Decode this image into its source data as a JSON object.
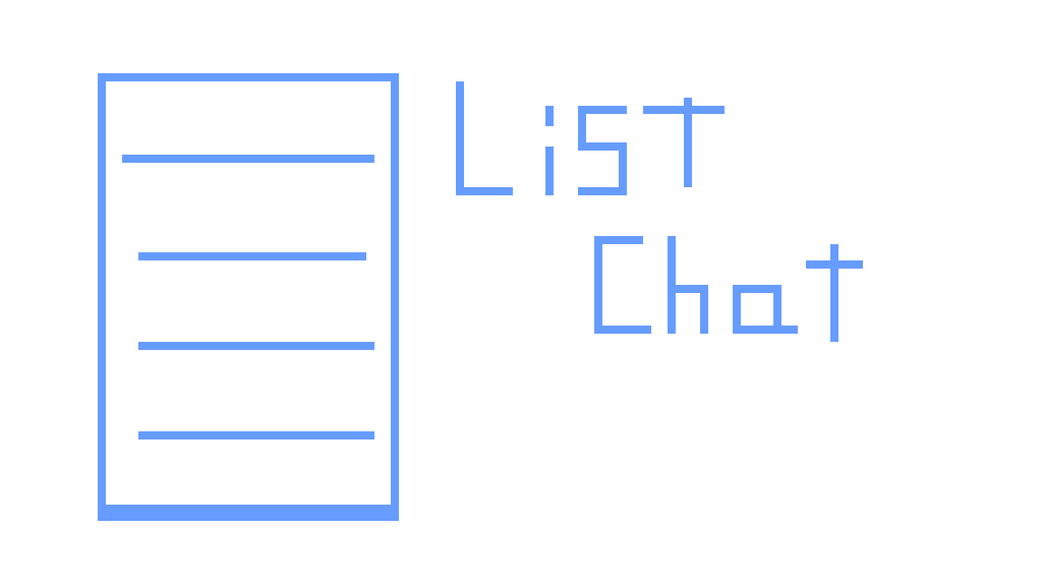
{
  "logo": {
    "line1": "List",
    "line2": "Chat",
    "accent_color": "#669cff",
    "background_color": "#ffffff"
  },
  "icons": {
    "list": "document-list-icon"
  }
}
